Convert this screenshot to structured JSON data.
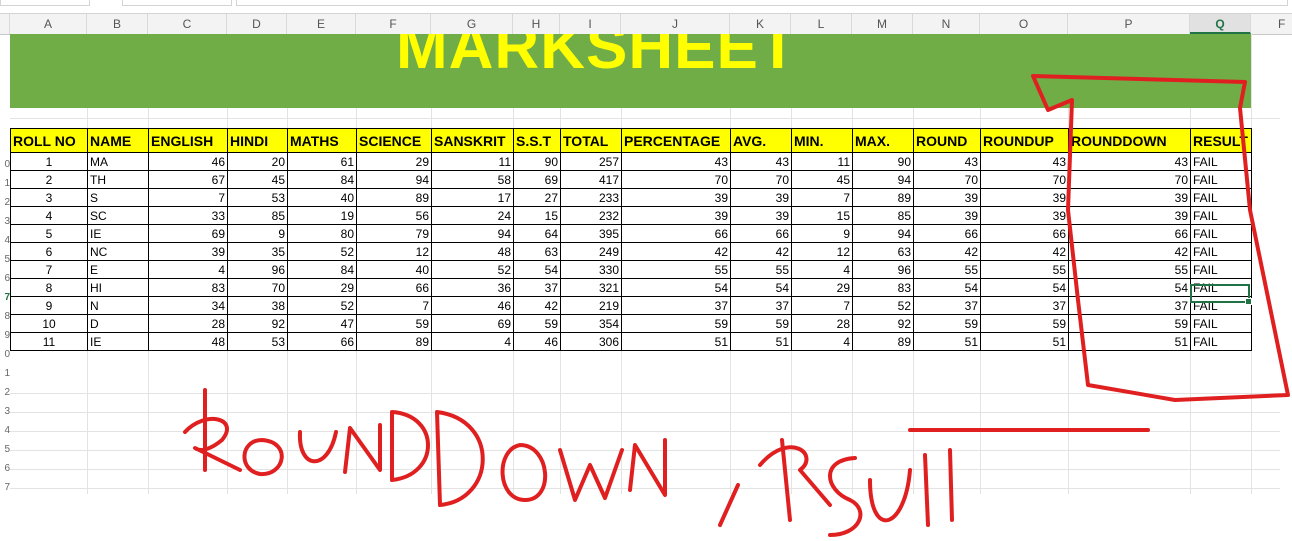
{
  "columns": [
    "A",
    "B",
    "C",
    "D",
    "E",
    "F",
    "G",
    "H",
    "I",
    "J",
    "K",
    "L",
    "M",
    "N",
    "O",
    "P",
    "Q",
    "F"
  ],
  "selected_column": "Q",
  "row_numbers": [
    "",
    "",
    "",
    "",
    "",
    "0",
    "1",
    "2",
    "3",
    "4",
    "5",
    "6",
    "7",
    "8",
    "9",
    "0",
    "1",
    "2",
    "3",
    "4",
    "5",
    "6",
    "7"
  ],
  "banner_title": "MARKSHEET",
  "table": {
    "headers": [
      "ROLL NO",
      "NAME",
      "ENGLISH",
      "HINDI",
      "MATHS",
      "SCIENCE",
      "SANSKRIT",
      "S.S.T",
      "TOTAL",
      "PERCENTAGE",
      "AVG.",
      "MIN.",
      "MAX.",
      "ROUND",
      "ROUNDUP",
      "ROUNDDOWN",
      "RESULT"
    ],
    "rows": [
      [
        "1",
        "MA",
        "46",
        "20",
        "61",
        "29",
        "11",
        "90",
        "257",
        "43",
        "43",
        "11",
        "90",
        "43",
        "43",
        "43",
        "FAIL"
      ],
      [
        "2",
        "TH",
        "67",
        "45",
        "84",
        "94",
        "58",
        "69",
        "417",
        "70",
        "70",
        "45",
        "94",
        "70",
        "70",
        "70",
        "FAIL"
      ],
      [
        "3",
        "S",
        "7",
        "53",
        "40",
        "89",
        "17",
        "27",
        "233",
        "39",
        "39",
        "7",
        "89",
        "39",
        "39",
        "39",
        "FAIL"
      ],
      [
        "4",
        "SC",
        "33",
        "85",
        "19",
        "56",
        "24",
        "15",
        "232",
        "39",
        "39",
        "15",
        "85",
        "39",
        "39",
        "39",
        "FAIL"
      ],
      [
        "5",
        "IE",
        "69",
        "9",
        "80",
        "79",
        "94",
        "64",
        "395",
        "66",
        "66",
        "9",
        "94",
        "66",
        "66",
        "66",
        "FAIL"
      ],
      [
        "6",
        "NC",
        "39",
        "35",
        "52",
        "12",
        "48",
        "63",
        "249",
        "42",
        "42",
        "12",
        "63",
        "42",
        "42",
        "42",
        "FAIL"
      ],
      [
        "7",
        "E",
        "4",
        "96",
        "84",
        "40",
        "52",
        "54",
        "330",
        "55",
        "55",
        "4",
        "96",
        "55",
        "55",
        "55",
        "FAIL"
      ],
      [
        "8",
        "HI",
        "83",
        "70",
        "29",
        "66",
        "36",
        "37",
        "321",
        "54",
        "54",
        "29",
        "83",
        "54",
        "54",
        "54",
        "FAIL"
      ],
      [
        "9",
        "N",
        "34",
        "38",
        "52",
        "7",
        "46",
        "42",
        "219",
        "37",
        "37",
        "7",
        "52",
        "37",
        "37",
        "37",
        "FAIL"
      ],
      [
        "10",
        "D",
        "28",
        "92",
        "47",
        "59",
        "69",
        "59",
        "354",
        "59",
        "59",
        "28",
        "92",
        "59",
        "59",
        "59",
        "FAIL"
      ],
      [
        "11",
        "IE",
        "48",
        "53",
        "66",
        "89",
        "4",
        "46",
        "306",
        "51",
        "51",
        "4",
        "89",
        "51",
        "51",
        "51",
        "FAIL"
      ]
    ]
  },
  "colors": {
    "banner_bg": "#70ad47",
    "banner_text": "#ffff00",
    "header_bg": "#ffff00",
    "annotation": "#e02020",
    "selection": "#217346"
  }
}
